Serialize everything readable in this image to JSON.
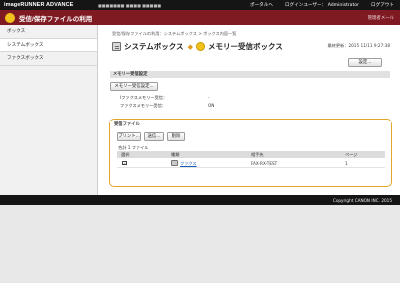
{
  "topbar": {
    "brand": "imageRUNNER ADVANCE",
    "device_name": "■■■■■■■ ■■■■ ■■■■■",
    "nav": [
      "ポータルへ",
      "ログインユーザー：",
      "Administrator",
      "ログアウト"
    ]
  },
  "titlebar": {
    "title": "受信/保存ファイルの利用",
    "right_link": "管理者メール"
  },
  "sidebar": {
    "items": [
      {
        "label": "ボックス"
      },
      {
        "label": "システムボックス"
      },
      {
        "label": "ファクスボックス"
      }
    ]
  },
  "main": {
    "breadcrumb": "受信/保存ファイルの利用：システムボックス > ボックス内容一覧",
    "heading_system_box": "システムボックス",
    "heading_separator": "◆",
    "heading_memory_box": "メモリー受信ボックス",
    "last_updated": "最終更新：2015 11/11 9:27:38",
    "settings_button": "設定...",
    "memory_settings": {
      "title": "メモリー受信設定",
      "button": "メモリー受信設定...",
      "rows": [
        {
          "label": "Iファクスメモリー受信：",
          "value": "-"
        },
        {
          "label": "ファクスメモリー受信：",
          "value": "ON"
        }
      ]
    },
    "received_files": {
      "title": "受信ファイル",
      "buttons": [
        "プリント...",
        "送信...",
        "削除"
      ],
      "count_text": "合計 1 ファイル",
      "columns": [
        "選択",
        "種類",
        "相手先",
        "ページ"
      ],
      "rows": [
        {
          "checked": "✓",
          "type": "ファクス",
          "destination": "FAX-RX-TEST",
          "pages": "1"
        }
      ]
    }
  },
  "footer": {
    "copyright": "Copyright CANON INC. 2015"
  },
  "colors": {
    "titlebar": "#7f1a22",
    "accent": "#e3a628",
    "link": "#1a5fb4"
  }
}
